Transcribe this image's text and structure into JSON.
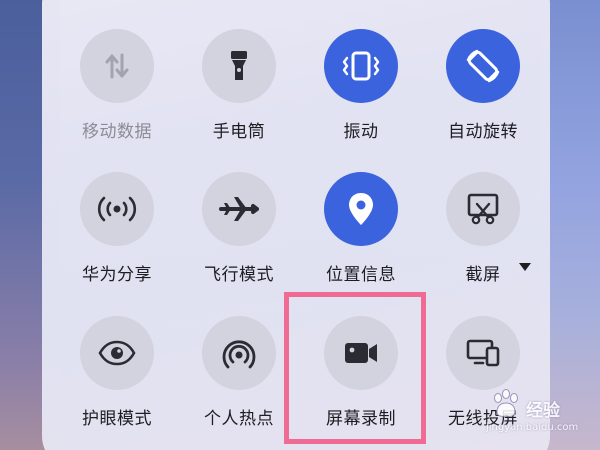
{
  "quick_settings": [
    {
      "id": "mobile-data",
      "label": "移动数据",
      "icon": "mobile-data-icon",
      "active": false,
      "disabled": true
    },
    {
      "id": "flashlight",
      "label": "手电筒",
      "icon": "flashlight-icon",
      "active": false,
      "disabled": false
    },
    {
      "id": "vibrate",
      "label": "振动",
      "icon": "vibrate-icon",
      "active": true,
      "disabled": false
    },
    {
      "id": "auto-rotate",
      "label": "自动旋转",
      "icon": "auto-rotate-icon",
      "active": true,
      "disabled": false
    },
    {
      "id": "huawei-share",
      "label": "华为分享",
      "icon": "share-signal-icon",
      "active": false,
      "disabled": false
    },
    {
      "id": "airplane-mode",
      "label": "飞行模式",
      "icon": "airplane-icon",
      "active": false,
      "disabled": false
    },
    {
      "id": "location",
      "label": "位置信息",
      "icon": "location-pin-icon",
      "active": true,
      "disabled": false
    },
    {
      "id": "screenshot",
      "label": "截屏",
      "icon": "screenshot-scissors-icon",
      "active": false,
      "disabled": false
    },
    {
      "id": "eye-comfort",
      "label": "护眼模式",
      "icon": "eye-icon",
      "active": false,
      "disabled": false
    },
    {
      "id": "hotspot",
      "label": "个人热点",
      "icon": "hotspot-icon",
      "active": false,
      "disabled": false
    },
    {
      "id": "screen-record",
      "label": "屏幕录制",
      "icon": "video-camera-icon",
      "active": false,
      "disabled": false
    },
    {
      "id": "wireless-projection",
      "label": "无线投屏",
      "icon": "projection-icon",
      "active": false,
      "disabled": false
    }
  ],
  "colors": {
    "active": "#3b63de",
    "inactive": "#d2d3df",
    "highlight_border": "#f06b94",
    "icon_dark": "#2b2c33"
  },
  "watermark": {
    "brand": "经验",
    "url": "jingyan.baidu.com"
  }
}
